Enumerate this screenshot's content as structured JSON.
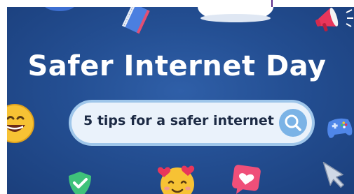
{
  "headline": "Safer Internet Day",
  "search": {
    "text": "5 tips for a safer internet",
    "button_icon": "search-icon"
  },
  "decorations": [
    "notebook-icon",
    "cloud-icon",
    "megaphone-icon",
    "grinning-emoji-icon",
    "game-controller-icon",
    "shield-check-icon",
    "heart-eyes-emoji-icon",
    "heart-bubble-icon",
    "cursor-arrow-icon"
  ],
  "colors": {
    "background": "#244f93",
    "headline": "#ffffff",
    "search_bar": "#eaf2fb",
    "search_button": "#7bb3e6"
  }
}
